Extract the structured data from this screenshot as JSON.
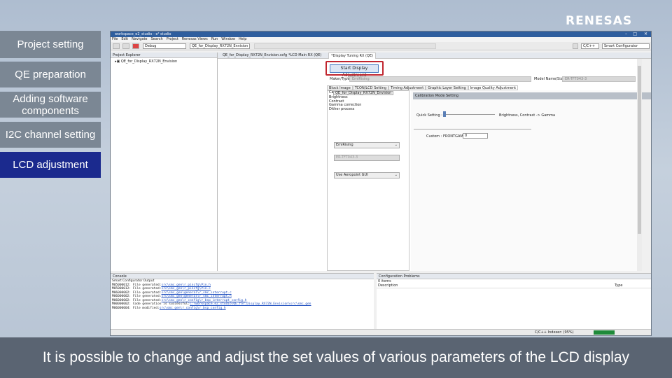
{
  "brand": {
    "logo": "RENESAS"
  },
  "side_menu": [
    {
      "label": "Project setting",
      "active": false
    },
    {
      "label": "QE preparation",
      "active": false
    },
    {
      "label": "Adding software components",
      "active": false
    },
    {
      "label": "I2C channel setting",
      "active": false
    },
    {
      "label": "LCD adjustment",
      "active": true
    }
  ],
  "caption": "It is possible to change and adjust the set values of various parameters of the LCD display",
  "window": {
    "title": "workspace_e2_studio - e² studio",
    "menu": [
      "File",
      "Edit",
      "Navigate",
      "Search",
      "Project",
      "Renesas Views",
      "Run",
      "Window",
      "Help"
    ],
    "toolbar": {
      "config_select": "Debug",
      "target_select": "QE_for_Display_RX72N_Envision H...",
      "perspective_cpp": "C/C++",
      "perspective_smart": "Smart Configurator"
    },
    "explorer": {
      "header": "Project Explorer",
      "project": "QE_for_Display_RX72N_Envision"
    },
    "editor_tabs": [
      {
        "label": "QE_for_Display_RX72N_Envision.scfg",
        "selected": false
      },
      {
        "label": "*LCD Main RX (QE)",
        "selected": false
      },
      {
        "label": "*Display Tuning RX (QE)",
        "selected": true
      }
    ],
    "editor": {
      "start_button": "Start Display Adjustment",
      "maker_label": "Maker/Type",
      "maker_value": "EmiRising",
      "model_label": "Model Name/Size",
      "model_value": "ER-TFT043-3",
      "sub_tabs": [
        "Block Image",
        "TCON/LCD Setting",
        "Timing Adjustment",
        "Graphic Layer Setting",
        "Image Quality Adjustment"
      ],
      "project_dropdown": "QE_for_Display_RX72N_Envision",
      "param_list": [
        "Ca",
        "Brightness",
        "Contrast",
        "Gamma correction",
        "Dither process"
      ],
      "combo_maker": "EmiRising",
      "combo_model": "ER-TFT043-3",
      "combo_gui": "Use Aeropoint GUI",
      "calib_header": "Calibration Mode Setting",
      "quick_label": "Quick Setting :",
      "quick_value_text": "Brightness, Contrast -> Gamma",
      "custom_label": "Custom :",
      "custom_name": "FRONTGAM",
      "custom_value": "0"
    },
    "console": {
      "header": "Console",
      "sub_header": "Smart Configurator Output",
      "lines": [
        {
          "code": "M05000012:",
          "text": "File generated:",
          "path": "src\\smc_gen\\r_pincfg\\Pin.h"
        },
        {
          "code": "M05000012:",
          "text": "File generated:",
          "path": "src\\smc_gen\\r_pincfg\\Pin.c"
        },
        {
          "code": "M06000002:",
          "text": "File generated:",
          "path": "src\\smc_gen\\general\\r_smc_interrupt.c"
        },
        {
          "code": "M06000002:",
          "text": "File generated:",
          "path": "src\\smc_gen\\general\\r_smc_interrupt.h"
        },
        {
          "code": "M06000002:",
          "text": "File generated:",
          "path": "src\\smc_gen\\r_config\\r_bsp_interrupt_config.h"
        },
        {
          "code": "M00000002:",
          "text": "Code generation is successful:",
          "path": "C:\\workspace_e2_studio\\QE_for_Display_RX72N_Envision\\src\\smc_gen"
        },
        {
          "code": "M06000004:",
          "text": "File modified:",
          "path": "src\\smc_gen\\r_config\\r_bsp_config.h"
        }
      ]
    },
    "problems": {
      "header": "Configuration Problems",
      "count": "0 items",
      "col_description": "Description",
      "col_type": "Type"
    },
    "status": {
      "indexer": "C/C++ Indexer: (95%)"
    }
  },
  "colors": {
    "accent": "#1b2a8e",
    "highlight": "#c0262f",
    "side": "#7b8794"
  }
}
